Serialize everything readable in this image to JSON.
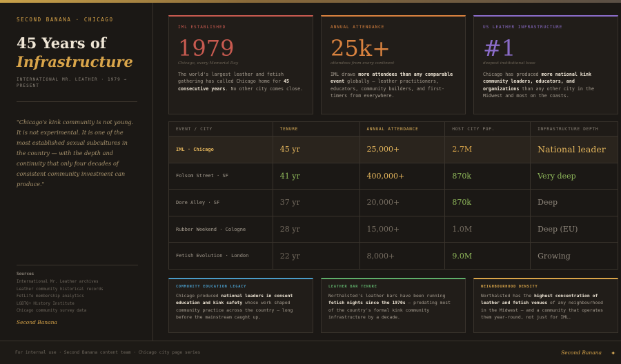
{
  "sidebar": {
    "eyebrow": "SECOND BANANA · CHICAGO",
    "title_line1": "45 Years of",
    "title_line2": "Infrastructure",
    "subtitle": "INTERNATIONAL MR. LEATHER · 1979 → PRESENT",
    "quote": "\"Chicago's kink community is not young. It is not experimental. It is one of the most established sexual subcultures in the country — with the depth and continuity that only four decades of consistent community investment can produce.\"",
    "sources_heading": "Sources",
    "sources": [
      "International Mr. Leather archives",
      "Leather community historical records",
      "FetLife membership analytics",
      "LGBTQ+ History Institute",
      "Chicago community survey data"
    ],
    "brand": "Second Banana"
  },
  "stats": [
    {
      "label": "IML ESTABLISHED",
      "value": "1979",
      "caption": "Chicago, every Memorial Day",
      "color": "#c85a50",
      "desc": [
        "The world's largest leather and fetish gathering has called Chicago home for ",
        "45 consecutive years",
        ". No other city comes close."
      ]
    },
    {
      "label": "ANNUAL ATTENDANCE",
      "value": "25k+",
      "caption": "attendees from every continent",
      "color": "#d9823f",
      "desc": [
        "IML draws ",
        "more attendees than any comparable event",
        " globally — leather practitioners, educators, community builders, and first-timers from everywhere."
      ]
    },
    {
      "label": "US LEATHER INFRASTRUCTURE",
      "value": "#1",
      "caption": "deepest institutional base",
      "color": "#8b6cc9",
      "desc": [
        "Chicago has produced ",
        "more national kink community leaders, educators, and organizations",
        " than any other city in the Midwest and most on the coasts."
      ]
    }
  ],
  "table": {
    "headers": [
      "EVENT / CITY",
      "TENURE",
      "ANNUAL ATTENDANCE",
      "HOST CITY POP.",
      "INFRASTRUCTURE DEPTH"
    ],
    "rows": [
      {
        "name": "IML · Chicago",
        "tenure": "45 yr",
        "attendance": "25,000+",
        "pop": "2.7M",
        "depth": "National leader",
        "colors": [
          "#e3b55c",
          "#e3b55c",
          "#d9a54a",
          "#e3b55c"
        ],
        "highlight": true
      },
      {
        "name": "Folsom Street · SF",
        "tenure": "41 yr",
        "attendance": "400,000+",
        "pop": "870k",
        "depth": "Very deep",
        "colors": [
          "#8fb85a",
          "#e3b55c",
          "#8fb85a",
          "#8fb85a"
        ],
        "highlight": false
      },
      {
        "name": "Dore Alley · SF",
        "tenure": "37 yr",
        "attendance": "20,000+",
        "pop": "870k",
        "depth": "Deep",
        "colors": [
          "#756c60",
          "#756c60",
          "#8fb85a",
          "#8d857a"
        ],
        "highlight": false
      },
      {
        "name": "Rubber Weekend · Cologne",
        "tenure": "28 yr",
        "attendance": "15,000+",
        "pop": "1.0M",
        "depth": "Deep (EU)",
        "colors": [
          "#756c60",
          "#756c60",
          "#756c60",
          "#8d857a"
        ],
        "highlight": false
      },
      {
        "name": "Fetish Evolution · London",
        "tenure": "22 yr",
        "attendance": "8,000+",
        "pop": "9.0M",
        "depth": "Growing",
        "colors": [
          "#756c60",
          "#756c60",
          "#8fb85a",
          "#8d857a"
        ],
        "highlight": false
      }
    ]
  },
  "facts": [
    {
      "label": "COMMUNITY EDUCATION LEGACY",
      "color": "#4a9cc9",
      "desc": [
        "Chicago produced ",
        "national leaders in consent education and kink safety",
        " whose work shaped community practice across the country — long before the mainstream caught up."
      ]
    },
    {
      "label": "LEATHER BAR TENURE",
      "color": "#5fae6a",
      "desc": [
        "Northalsted's leather bars have been running ",
        "fetish nights since the 1970s",
        " — predating most of the country's formal kink community infrastructure by a decade."
      ]
    },
    {
      "label": "NEIGHBOURHOOD DENSITY",
      "color": "#d9a54a",
      "desc": [
        "Northalsted has the ",
        "highest concentration of leather and fetish venues",
        " of any neighbourhood in the Midwest — and a community that operates them year-round, not just for IML."
      ]
    }
  ],
  "footer": {
    "note": "For internal use · Second Banana content team · Chicago city page series",
    "brand": "Second Banana"
  }
}
